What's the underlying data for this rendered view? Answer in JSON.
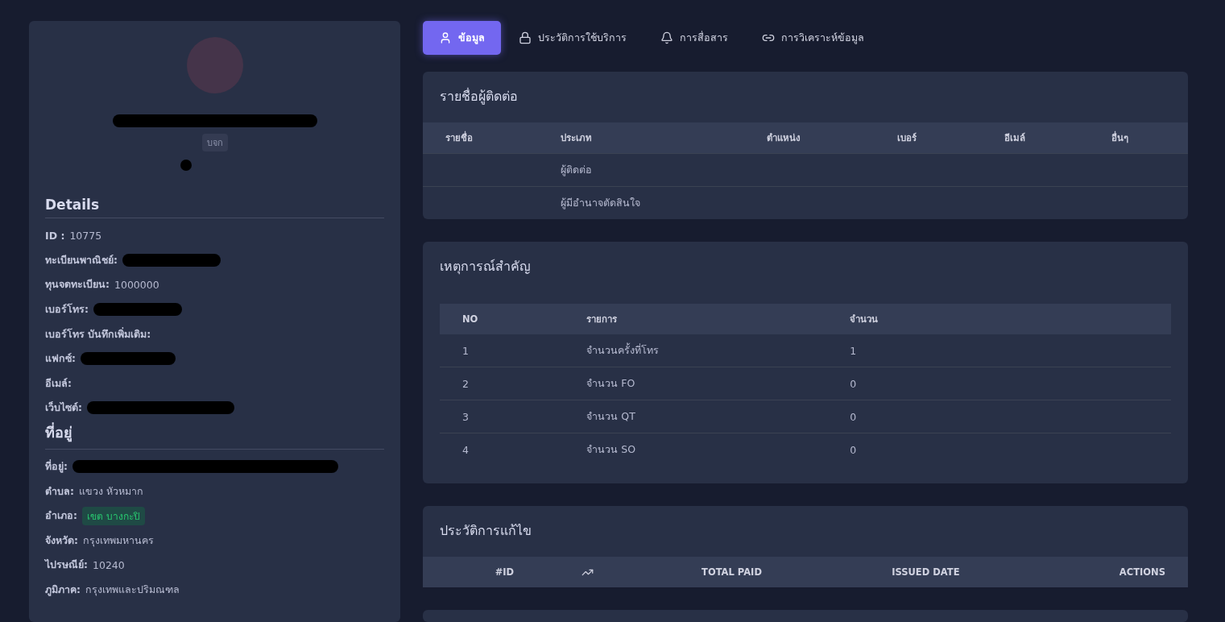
{
  "profile": {
    "badge": "บจก",
    "details_title": "Details",
    "details": [
      {
        "label": "ID :",
        "value": "10775",
        "kind": "plain"
      },
      {
        "label": "ทะเบียนพาณิชย์:",
        "kind": "redacted"
      },
      {
        "label": "ทุนจดทะเบียน:",
        "value": "1000000",
        "kind": "plain"
      },
      {
        "label": "เบอร์โทร:",
        "kind": "redacted"
      },
      {
        "label": "เบอร์โทร บันทึกเพิ่มเติม:",
        "kind": "plain"
      },
      {
        "label": "แฟกซ์:",
        "kind": "redacted"
      },
      {
        "label": "อีเมล์:",
        "kind": "plain"
      },
      {
        "label": "เว็บไซต์:",
        "kind": "redacted"
      }
    ],
    "address_title": "ที่อยู่",
    "address": [
      {
        "label": "ที่อยู่:",
        "kind": "redacted"
      },
      {
        "label": "ตำบล:",
        "value": "แขวง หัวหมาก",
        "kind": "plain"
      },
      {
        "label": "อำเภอ:",
        "value": "เขต บางกะปิ",
        "kind": "tag"
      },
      {
        "label": "จังหวัด:",
        "value": "กรุงเทพมหานคร",
        "kind": "plain"
      },
      {
        "label": "ไปรษณีย์:",
        "value": "10240",
        "kind": "plain"
      },
      {
        "label": "ภูมิภาค:",
        "value": "กรุงเทพและปริมณฑล",
        "kind": "plain"
      }
    ]
  },
  "tabs": [
    {
      "label": "ข้อมูล",
      "selected": true
    },
    {
      "label": "ประวัติการใช้บริการ",
      "selected": false
    },
    {
      "label": "การสื่อสาร",
      "selected": false
    },
    {
      "label": "การวิเคราะห์ข้อมูล",
      "selected": false
    }
  ],
  "contacts": {
    "title": "รายชื่อผู้ติดต่อ",
    "columns": [
      "รายชื่อ",
      "ประเภท",
      "ตำแหน่ง",
      "เบอร์",
      "อีเมล์",
      "อื่นๆ"
    ],
    "rows": [
      [
        "",
        "ผู้ติดต่อ",
        "",
        "",
        "",
        ""
      ],
      [
        "",
        "ผู้มีอำนาจตัดสินใจ",
        "",
        "",
        "",
        ""
      ]
    ]
  },
  "events": {
    "title": "เหตุการณ์สำคัญ",
    "columns": [
      "NO",
      "รายการ",
      "จำนวน"
    ],
    "rows": [
      [
        "1",
        "จำนวนครั้งที่โทร",
        "1"
      ],
      [
        "2",
        "จำนวน FO",
        "0"
      ],
      [
        "3",
        "จำนวน QT",
        "0"
      ],
      [
        "4",
        "จำนวน SO",
        "0"
      ]
    ]
  },
  "history": {
    "title": "ประวัติการแก้ไข",
    "columns": [
      {
        "label": "#ID",
        "kind": "text"
      },
      {
        "kind": "trend"
      },
      {
        "label": "TOTAL PAID",
        "kind": "text"
      },
      {
        "label": "ISSUED DATE",
        "kind": "text"
      },
      {
        "label": "ACTIONS",
        "kind": "text"
      }
    ]
  }
}
